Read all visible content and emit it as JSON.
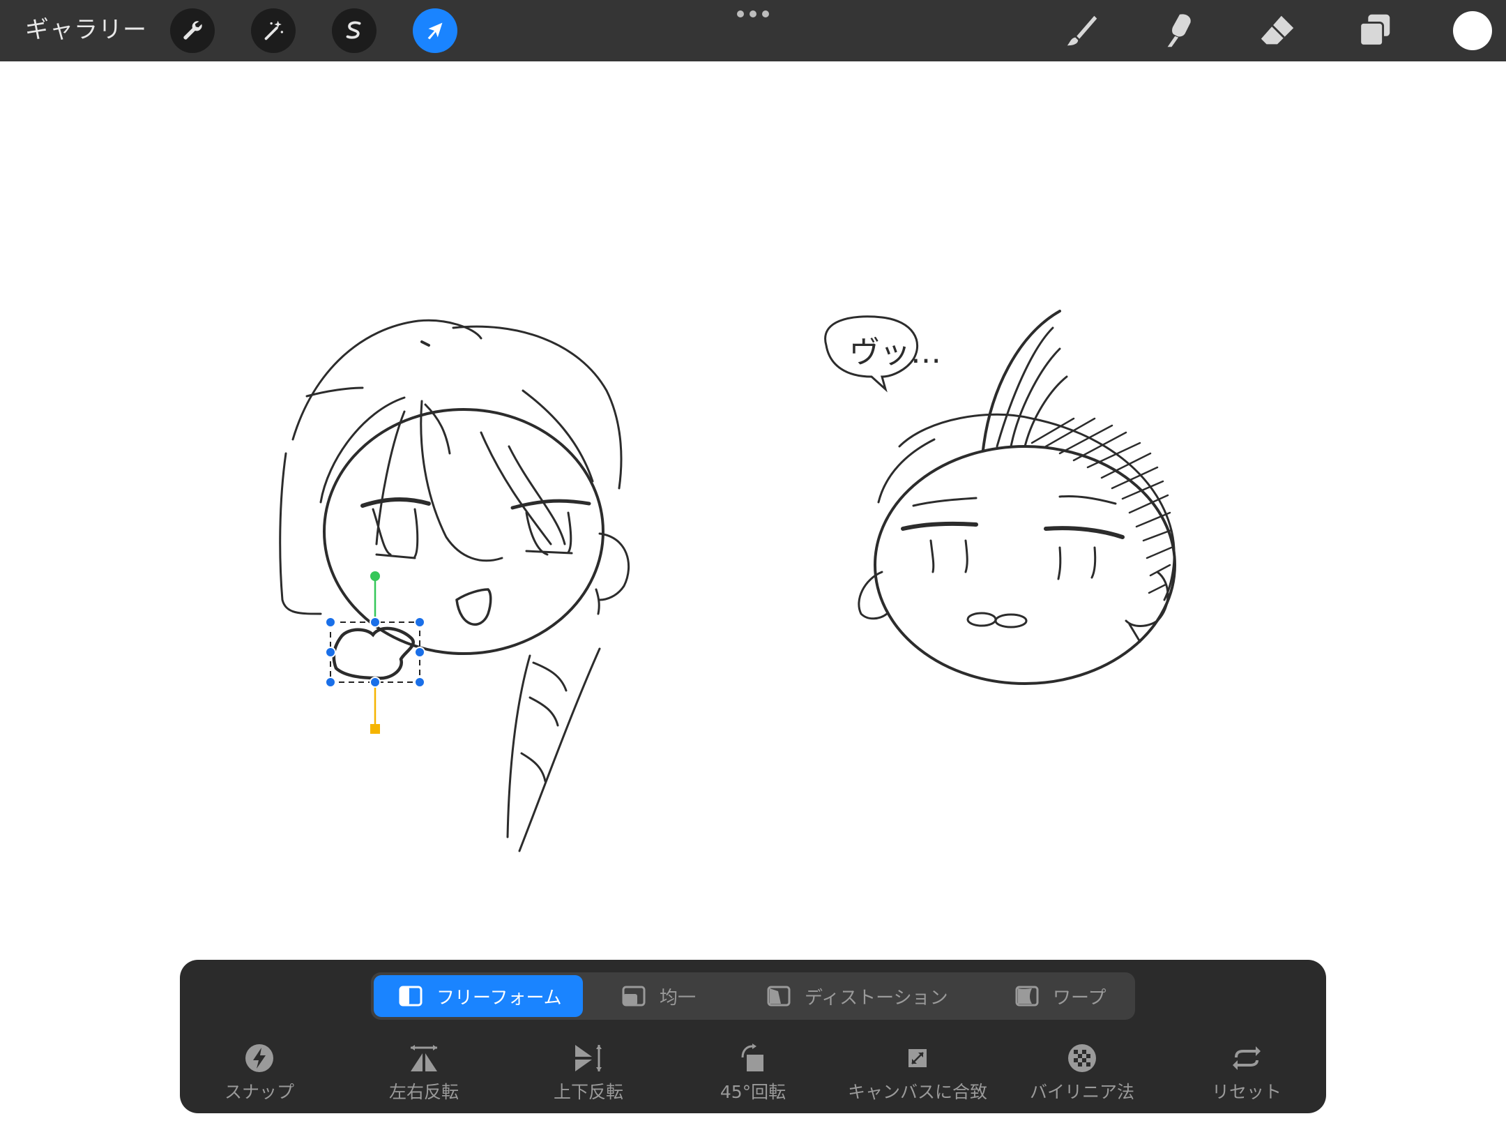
{
  "topbar": {
    "gallery_label": "ギャラリー",
    "tools": [
      {
        "name": "actions-wrench",
        "icon": "wrench-icon"
      },
      {
        "name": "adjustments",
        "icon": "magic-wand-icon"
      },
      {
        "name": "selection",
        "icon": "selection-s-icon"
      },
      {
        "name": "transform",
        "icon": "arrow-cursor-icon",
        "active": true
      }
    ],
    "right_tools": [
      "brush-icon",
      "smudge-icon",
      "eraser-icon",
      "layers-icon"
    ],
    "current_color": "#ffffff",
    "accent": "#1a84ff"
  },
  "canvas": {
    "speech_bubble_text": "ヴッ…"
  },
  "transform_modes": [
    {
      "label": "フリーフォーム",
      "icon": "freeform-icon",
      "active": true
    },
    {
      "label": "均一",
      "icon": "uniform-icon",
      "active": false
    },
    {
      "label": "ディストーション",
      "icon": "distort-icon",
      "active": false
    },
    {
      "label": "ワープ",
      "icon": "warp-icon",
      "active": false
    }
  ],
  "actions": [
    {
      "label": "スナップ",
      "icon": "snap-bolt-icon"
    },
    {
      "label": "左右反転",
      "icon": "flip-horizontal-icon"
    },
    {
      "label": "上下反転",
      "icon": "flip-vertical-icon"
    },
    {
      "label": "45°回転",
      "icon": "rotate-45-icon"
    },
    {
      "label": "キャンバスに合致",
      "icon": "fit-canvas-icon"
    },
    {
      "label": "バイリニア法",
      "icon": "bilinear-checker-icon"
    },
    {
      "label": "リセット",
      "icon": "reset-arrows-icon"
    }
  ]
}
